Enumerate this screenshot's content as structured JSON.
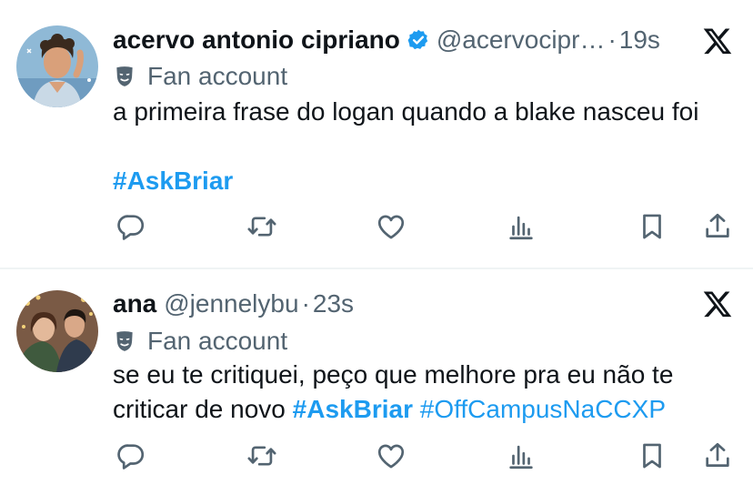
{
  "colors": {
    "text_primary": "#0f1419",
    "text_secondary": "#536471",
    "accent": "#1d9bf0",
    "divider": "#eff3f4"
  },
  "tweets": [
    {
      "display_name": "acervo antonio cipriano",
      "verified": true,
      "handle": "@acervocipr…",
      "separator": "·",
      "time": "19s",
      "label": "Fan account",
      "label_icon": "mask-icon",
      "text_lines": [
        "a primeira frase do logan quando a blake nasceu foi"
      ],
      "hashtags": [
        "#AskBriar"
      ],
      "actions": [
        "reply-icon",
        "retweet-icon",
        "like-icon",
        "views-icon",
        "bookmark-icon",
        "share-icon"
      ],
      "source_icon": "x-logo-icon"
    },
    {
      "display_name": "ana",
      "verified": false,
      "handle": "@jennelybu",
      "separator": "·",
      "time": "23s",
      "label": "Fan account",
      "label_icon": "mask-icon",
      "text_lines": [
        "se eu te critiquei, peço que melhore pra eu não te",
        "criticar de novo"
      ],
      "hashtags": [
        "#AskBriar",
        "#OffCampusNaCCXP"
      ],
      "actions": [
        "reply-icon",
        "retweet-icon",
        "like-icon",
        "views-icon",
        "bookmark-icon",
        "share-icon"
      ],
      "source_icon": "x-logo-icon"
    }
  ]
}
